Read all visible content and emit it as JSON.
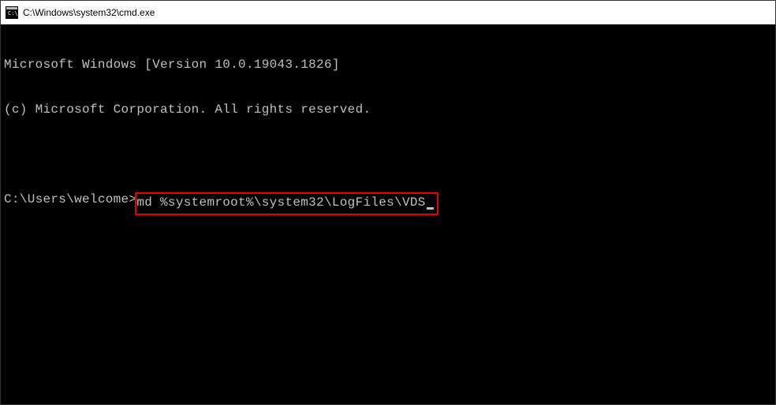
{
  "titlebar": {
    "title": "C:\\Windows\\system32\\cmd.exe"
  },
  "console": {
    "version_line": "Microsoft Windows [Version 10.0.19043.1826]",
    "copyright_line": "(c) Microsoft Corporation. All rights reserved.",
    "prompt": "C:\\Users\\welcome>",
    "command": "md %systemroot%\\system32\\LogFiles\\VDS"
  }
}
